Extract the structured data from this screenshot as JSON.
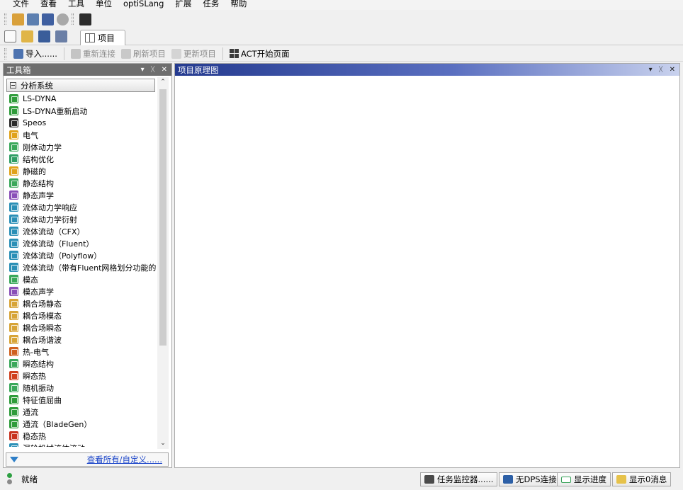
{
  "menu": [
    "文件",
    "查看",
    "工具",
    "单位",
    "optiSLang",
    "扩展",
    "任务",
    "帮助"
  ],
  "tab": {
    "label": "项目"
  },
  "toolbar2": {
    "import": "导入......",
    "reconnect": "重新连接",
    "refresh": "刷新项目",
    "update": "更新项目",
    "act": "ACT开始页面"
  },
  "toolbox": {
    "title": "工具箱",
    "group": "分析系统",
    "items": [
      {
        "label": "LS-DYNA",
        "color": "#2e9c3a"
      },
      {
        "label": "LS-DYNA重新启动",
        "color": "#2e9c3a"
      },
      {
        "label": "Speos",
        "color": "#2b2b2b"
      },
      {
        "label": "电气",
        "color": "#e0a21a"
      },
      {
        "label": "刚体动力学",
        "color": "#3aa85a"
      },
      {
        "label": "结构优化",
        "color": "#2f9e64"
      },
      {
        "label": "静磁的",
        "color": "#e0a21a"
      },
      {
        "label": "静态结构",
        "color": "#3aa85a"
      },
      {
        "label": "静态声学",
        "color": "#8a4fb8"
      },
      {
        "label": "流体动力学响应",
        "color": "#2a8fb6"
      },
      {
        "label": "流体动力学衍射",
        "color": "#2a8fb6"
      },
      {
        "label": "流体流动（CFX）",
        "color": "#2a8fb6"
      },
      {
        "label": "流体流动（Fluent）",
        "color": "#2a8fb6"
      },
      {
        "label": "流体流动（Polyflow）",
        "color": "#2a8fb6"
      },
      {
        "label": "流体流动（带有Fluent网格划分功能的",
        "color": "#2a8fb6"
      },
      {
        "label": "模态",
        "color": "#3aa85a"
      },
      {
        "label": "模态声学",
        "color": "#8a4fb8"
      },
      {
        "label": "耦合场静态",
        "color": "#d7a437"
      },
      {
        "label": "耦合场模态",
        "color": "#d7a437"
      },
      {
        "label": "耦合场瞬态",
        "color": "#d7a437"
      },
      {
        "label": "耦合场谐波",
        "color": "#d7a437"
      },
      {
        "label": "热-电气",
        "color": "#d0601e"
      },
      {
        "label": "瞬态结构",
        "color": "#3aa85a"
      },
      {
        "label": "瞬态热",
        "color": "#d0401e"
      },
      {
        "label": "随机振动",
        "color": "#3aa85a"
      },
      {
        "label": "特征值屈曲",
        "color": "#2e9c3a"
      },
      {
        "label": "通流",
        "color": "#2e9c3a"
      },
      {
        "label": "通流（BladeGen）",
        "color": "#2e9c3a"
      },
      {
        "label": "稳态热",
        "color": "#c8321e"
      },
      {
        "label": "涡轮机械流体流动",
        "color": "#2a8fb6"
      }
    ],
    "footer_link": "查看所有/自定义......"
  },
  "schematic": {
    "title": "项目原理图"
  },
  "status": {
    "text": "就绪",
    "task_monitor": "任务监控器......",
    "no_dps": "无DPS连接",
    "show_progress": "显示进度",
    "show_messages": "显示0消息"
  }
}
